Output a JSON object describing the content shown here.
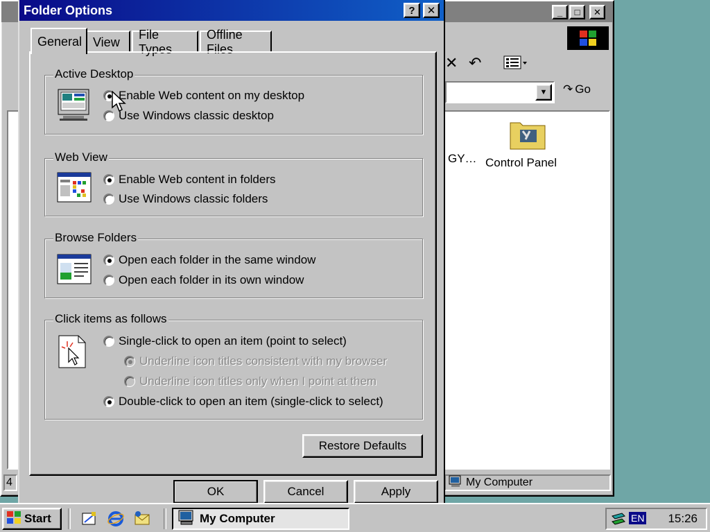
{
  "explorer": {
    "title_buttons": [
      "minimize-icon",
      "maximize-icon",
      "close-icon"
    ],
    "address_go": "Go",
    "items": [
      {
        "label": "GY…"
      },
      {
        "label": "Control Panel",
        "icon": "control-panel-folder-icon"
      }
    ],
    "status_left": "4",
    "status_zone": "My Computer"
  },
  "dialog": {
    "title": "Folder Options",
    "help_glyph": "?",
    "close_glyph": "✕",
    "tabs": [
      "General",
      "View",
      "File Types",
      "Offline Files"
    ],
    "active_tab": "General",
    "groups": {
      "active_desktop": {
        "label": "Active Desktop",
        "options": [
          {
            "label": "Enable Web content on my desktop",
            "checked": true
          },
          {
            "label": "Use Windows classic desktop",
            "checked": false
          }
        ]
      },
      "web_view": {
        "label": "Web View",
        "options": [
          {
            "label": "Enable Web content in folders",
            "checked": true
          },
          {
            "label": "Use Windows classic folders",
            "checked": false
          }
        ]
      },
      "browse_folders": {
        "label": "Browse Folders",
        "options": [
          {
            "label": "Open each folder in the same window",
            "checked": true
          },
          {
            "label": "Open each folder in its own window",
            "checked": false
          }
        ]
      },
      "click_items": {
        "label": "Click items as follows",
        "options": [
          {
            "label": "Single-click to open an item (point to select)",
            "checked": false
          },
          {
            "label": "Underline icon titles consistent with my browser",
            "checked": true,
            "disabled": true
          },
          {
            "label": "Underline icon titles only when I point at them",
            "checked": false,
            "disabled": true
          },
          {
            "label": "Double-click to open an item (single-click to select)",
            "checked": true
          }
        ]
      }
    },
    "restore_defaults": "Restore Defaults",
    "ok": "OK",
    "cancel": "Cancel",
    "apply": "Apply"
  },
  "taskbar": {
    "start": "Start",
    "quick_launch": [
      "show-desktop-icon",
      "internet-explorer-icon",
      "outlook-express-icon"
    ],
    "task": "My Computer",
    "language": "EN",
    "clock": "15:26"
  },
  "colors": {
    "desktop": "#6fa6a6",
    "title_bar": "#0a0a88",
    "face": "#c3c3c3"
  }
}
